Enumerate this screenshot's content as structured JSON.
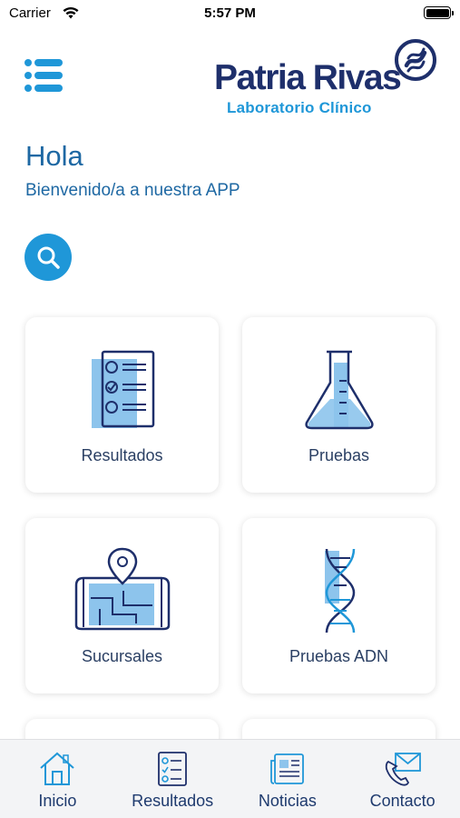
{
  "status_bar": {
    "carrier": "Carrier",
    "time": "5:57 PM"
  },
  "header": {
    "logo_name": "Patria Rivas",
    "logo_subtitle": "Laboratorio Clínico",
    "menu_icon": "hamburger-icon"
  },
  "greeting": {
    "title": "Hola",
    "subtitle": "Bienvenido/a a nuestra APP"
  },
  "search": {
    "icon": "search-icon"
  },
  "cards": [
    {
      "label": "Resultados",
      "icon": "results-checklist-icon"
    },
    {
      "label": "Pruebas",
      "icon": "flask-icon"
    },
    {
      "label": "Sucursales",
      "icon": "map-pin-icon"
    },
    {
      "label": "Pruebas ADN",
      "icon": "dna-icon"
    }
  ],
  "tab_bar": {
    "tabs": [
      {
        "label": "Inicio",
        "icon": "home-icon"
      },
      {
        "label": "Resultados",
        "icon": "checklist-icon"
      },
      {
        "label": "Noticias",
        "icon": "newspaper-icon"
      },
      {
        "label": "Contacto",
        "icon": "phone-mail-icon"
      }
    ]
  },
  "colors": {
    "primary_blue": "#1f97d8",
    "navy": "#1e2f6b",
    "text_blue": "#1e68a3",
    "icon_fill": "#8dc4ec"
  }
}
